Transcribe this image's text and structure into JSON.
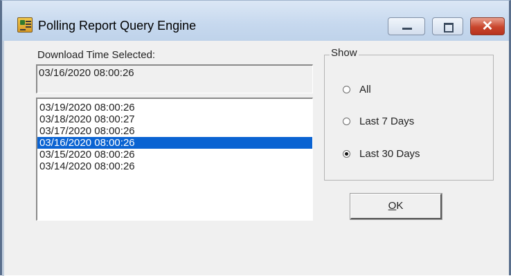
{
  "window": {
    "title": "Polling Report Query Engine",
    "icon": "app-report-icon",
    "controls": {
      "minimize": "minimize-icon",
      "maximize": "maximize-icon",
      "close_glyph": "✕"
    }
  },
  "download": {
    "label": "Download Time Selected:",
    "selected_value": "03/16/2020 08:00:26"
  },
  "list": {
    "items": [
      "03/19/2020 08:00:26",
      "03/18/2020 08:00:27",
      "03/17/2020 08:00:26",
      "03/16/2020 08:00:26",
      "03/15/2020 08:00:26",
      "03/14/2020 08:00:26"
    ],
    "selected_index": 3
  },
  "show": {
    "legend": "Show",
    "options": [
      {
        "label": "All",
        "checked": false
      },
      {
        "label": "Last 7 Days",
        "checked": false
      },
      {
        "label": "Last 30 Days",
        "checked": true
      }
    ]
  },
  "ok": {
    "accel": "O",
    "rest": "K"
  },
  "colors": {
    "selection": "#0a63d2",
    "titlebar": "#c6d8ee",
    "close": "#c8452c"
  }
}
